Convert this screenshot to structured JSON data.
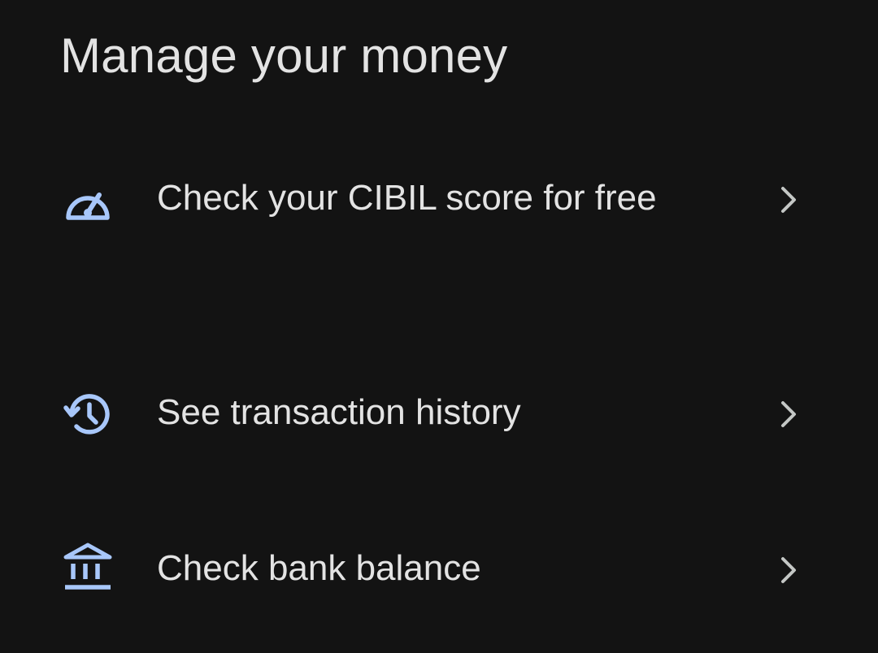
{
  "section": {
    "title": "Manage your money"
  },
  "items": [
    {
      "label": "Check your CIBIL score for free",
      "icon": "speedometer-icon"
    },
    {
      "label": "See transaction history",
      "icon": "history-icon"
    },
    {
      "label": "Check bank balance",
      "icon": "bank-icon"
    }
  ],
  "colors": {
    "background": "#131313",
    "text": "#e3e3e3",
    "icon_accent": "#a8c7fa",
    "chevron": "#c4c7c5"
  }
}
